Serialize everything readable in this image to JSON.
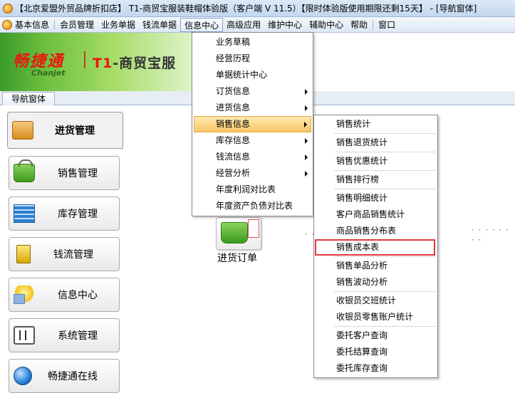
{
  "window": {
    "title": "【北京爱盟外贸品牌折扣店】 T1-商贸宝服装鞋帽体验版（客户端 V 11.5）【限时体验版使用期限还剩15天】 - [导航窗体]"
  },
  "menubar": {
    "items": [
      {
        "label": "基本信息"
      },
      {
        "label": "会员管理"
      },
      {
        "label": "业务单据"
      },
      {
        "label": "钱流单据"
      },
      {
        "label": "信息中心"
      },
      {
        "label": "高级应用"
      },
      {
        "label": "维护中心"
      },
      {
        "label": "辅助中心"
      },
      {
        "label": "帮助"
      },
      {
        "label": "窗口"
      }
    ],
    "active_index": 4
  },
  "banner": {
    "logo_cn": "畅捷通",
    "logo_en": "Chanjet",
    "product_t1": "T1",
    "product_rest": "-商贸宝服"
  },
  "tabs": {
    "nav_tab": "导航窗体"
  },
  "leftnav": {
    "items": [
      {
        "label": "进货管理",
        "icon": "cart-icon",
        "active": true
      },
      {
        "label": "销售管理",
        "icon": "basket-icon"
      },
      {
        "label": "库存管理",
        "icon": "inventory-grid-icon"
      },
      {
        "label": "钱流管理",
        "icon": "cash-icon"
      },
      {
        "label": "信息中心",
        "icon": "info-bulb-icon"
      },
      {
        "label": "系统管理",
        "icon": "system-settings-icon"
      },
      {
        "label": "畅捷通在线",
        "icon": "globe-icon"
      }
    ]
  },
  "workspace": {
    "center_label": "进货订单",
    "dots_left": "· ·",
    "dots_right": "· · · · · · · ·"
  },
  "info_menu": {
    "items": [
      {
        "label": "业务草稿"
      },
      {
        "label": "经营历程"
      },
      {
        "label": "单据统计中心"
      },
      {
        "label": "订货信息",
        "submenu": true
      },
      {
        "label": "进货信息",
        "submenu": true
      },
      {
        "label": "销售信息",
        "submenu": true,
        "highlighted": true
      },
      {
        "label": "库存信息",
        "submenu": true
      },
      {
        "label": "钱流信息",
        "submenu": true
      },
      {
        "label": "经营分析",
        "submenu": true
      },
      {
        "label": "年度利润对比表"
      },
      {
        "label": "年度资产负债对比表"
      }
    ]
  },
  "sales_submenu": {
    "items": [
      {
        "label": "销售统计"
      },
      {
        "label": "销售退货统计"
      },
      {
        "label": "销售优惠统计"
      },
      {
        "label": "销售排行榜"
      },
      {
        "label": "销售明细统计"
      },
      {
        "label": "客户商品销售统计"
      },
      {
        "label": "商品销售分布表"
      },
      {
        "label": "销售成本表",
        "boxed": true
      },
      {
        "label": "销售单品分析"
      },
      {
        "label": "销售波动分析"
      },
      {
        "label": "收银员交班统计"
      },
      {
        "label": "收银员零售账户统计"
      },
      {
        "label": "委托客户查询"
      },
      {
        "label": "委托结算查询"
      },
      {
        "label": "委托库存查询"
      }
    ],
    "highlight_color": "#e23a3a"
  }
}
